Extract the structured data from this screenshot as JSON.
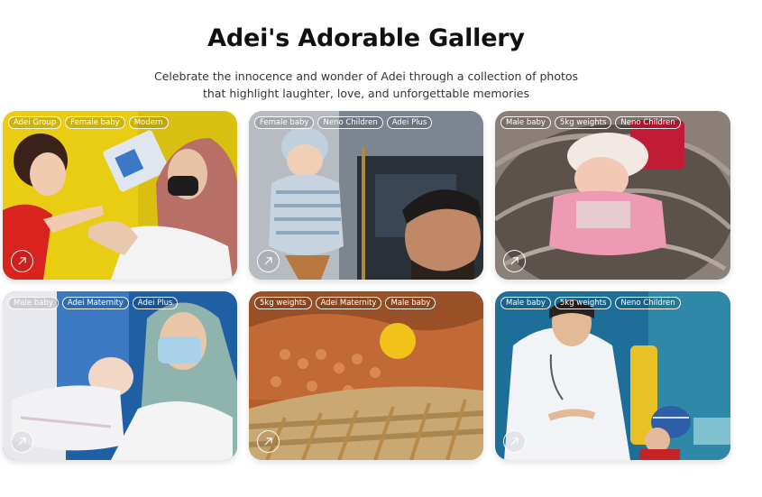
{
  "header": {
    "title": "Adei's Adorable Gallery",
    "subtitle": "Celebrate the innocence and wonder of Adei through a collection of photos that highlight laughter, love, and unforgettable memories"
  },
  "gallery": {
    "cards": [
      {
        "tags": [
          "Adei Group",
          "Female baby",
          "Modern"
        ],
        "open_icon": "arrow-up-right-icon"
      },
      {
        "tags": [
          "Female baby",
          "Neno Children",
          "Adei Plus"
        ],
        "open_icon": "arrow-up-right-icon"
      },
      {
        "tags": [
          "Male baby",
          "5kg weights",
          "Neno Children"
        ],
        "open_icon": "arrow-up-right-icon"
      },
      {
        "tags": [
          "Male baby",
          "Adei Maternity",
          "Adei Plus"
        ],
        "open_icon": "arrow-up-right-icon"
      },
      {
        "tags": [
          "5kg weights",
          "Adei Maternity",
          "Male baby"
        ],
        "open_icon": "arrow-up-right-icon"
      },
      {
        "tags": [
          "Male baby",
          "5kg weights",
          "Neno Children"
        ],
        "open_icon": "arrow-up-right-icon"
      }
    ]
  },
  "colors": {
    "background": "#ffffff",
    "tag_border": "#ffffff",
    "title": "#111111"
  }
}
